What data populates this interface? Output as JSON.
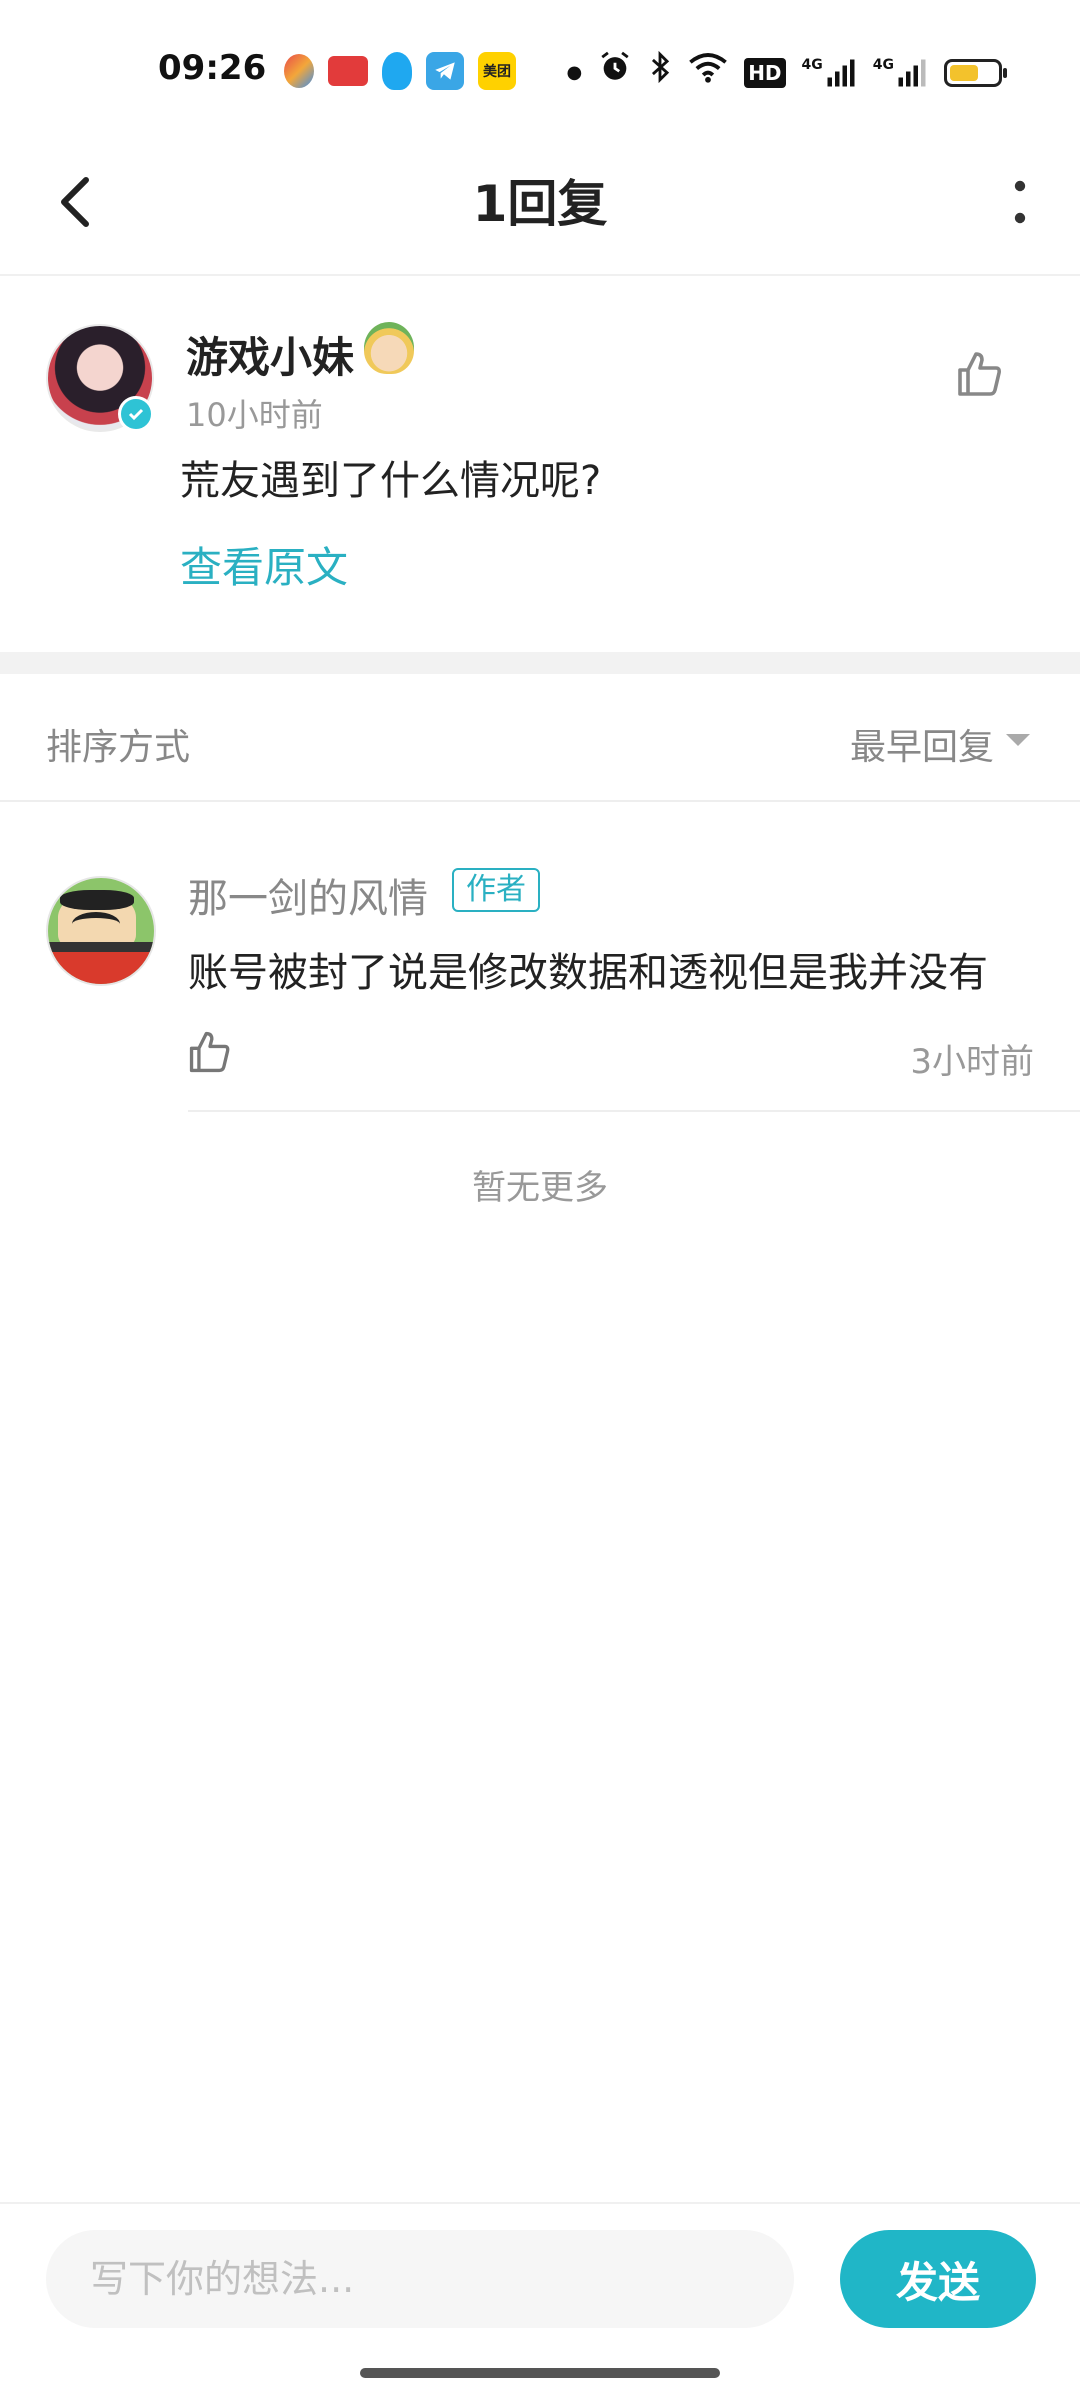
{
  "status_bar": {
    "time": "09:26",
    "notification_icons": [
      "app-icon-colorful",
      "app-icon-red",
      "qq-icon",
      "telegram-icon",
      "meituan-icon"
    ],
    "meituan_label": "美团",
    "system_icons": [
      "dot-icon",
      "alarm-icon",
      "bluetooth-icon",
      "wifi-icon",
      "hd-icon",
      "signal-4g-icon",
      "signal-4g-icon",
      "battery-icon"
    ],
    "hd_label": "HD",
    "network_label_1": "4G",
    "network_label_2": "4G",
    "battery_level": 0.6,
    "battery_color": "#f3c22c"
  },
  "navbar": {
    "title": "1回复",
    "back_icon": "chevron-left-icon",
    "more_icon": "more-vertical-icon"
  },
  "post": {
    "username": "游戏小妹",
    "time": "10小时前",
    "content": "荒友遇到了什么情况呢?",
    "view_original": "查看原文",
    "like_icon": "thumbs-up-icon"
  },
  "sort": {
    "label": "排序方式",
    "value": "最早回复"
  },
  "replies": [
    {
      "username": "那一剑的风情",
      "tag": "作者",
      "content": "账号被封了说是修改数据和透视但是我并没有",
      "time": "3小时前"
    }
  ],
  "no_more": "暂无更多",
  "composer": {
    "placeholder": "写下你的想法...",
    "send_label": "发送"
  },
  "colors": {
    "accent": "#2ab0c2",
    "send_button": "#20b6c7"
  }
}
